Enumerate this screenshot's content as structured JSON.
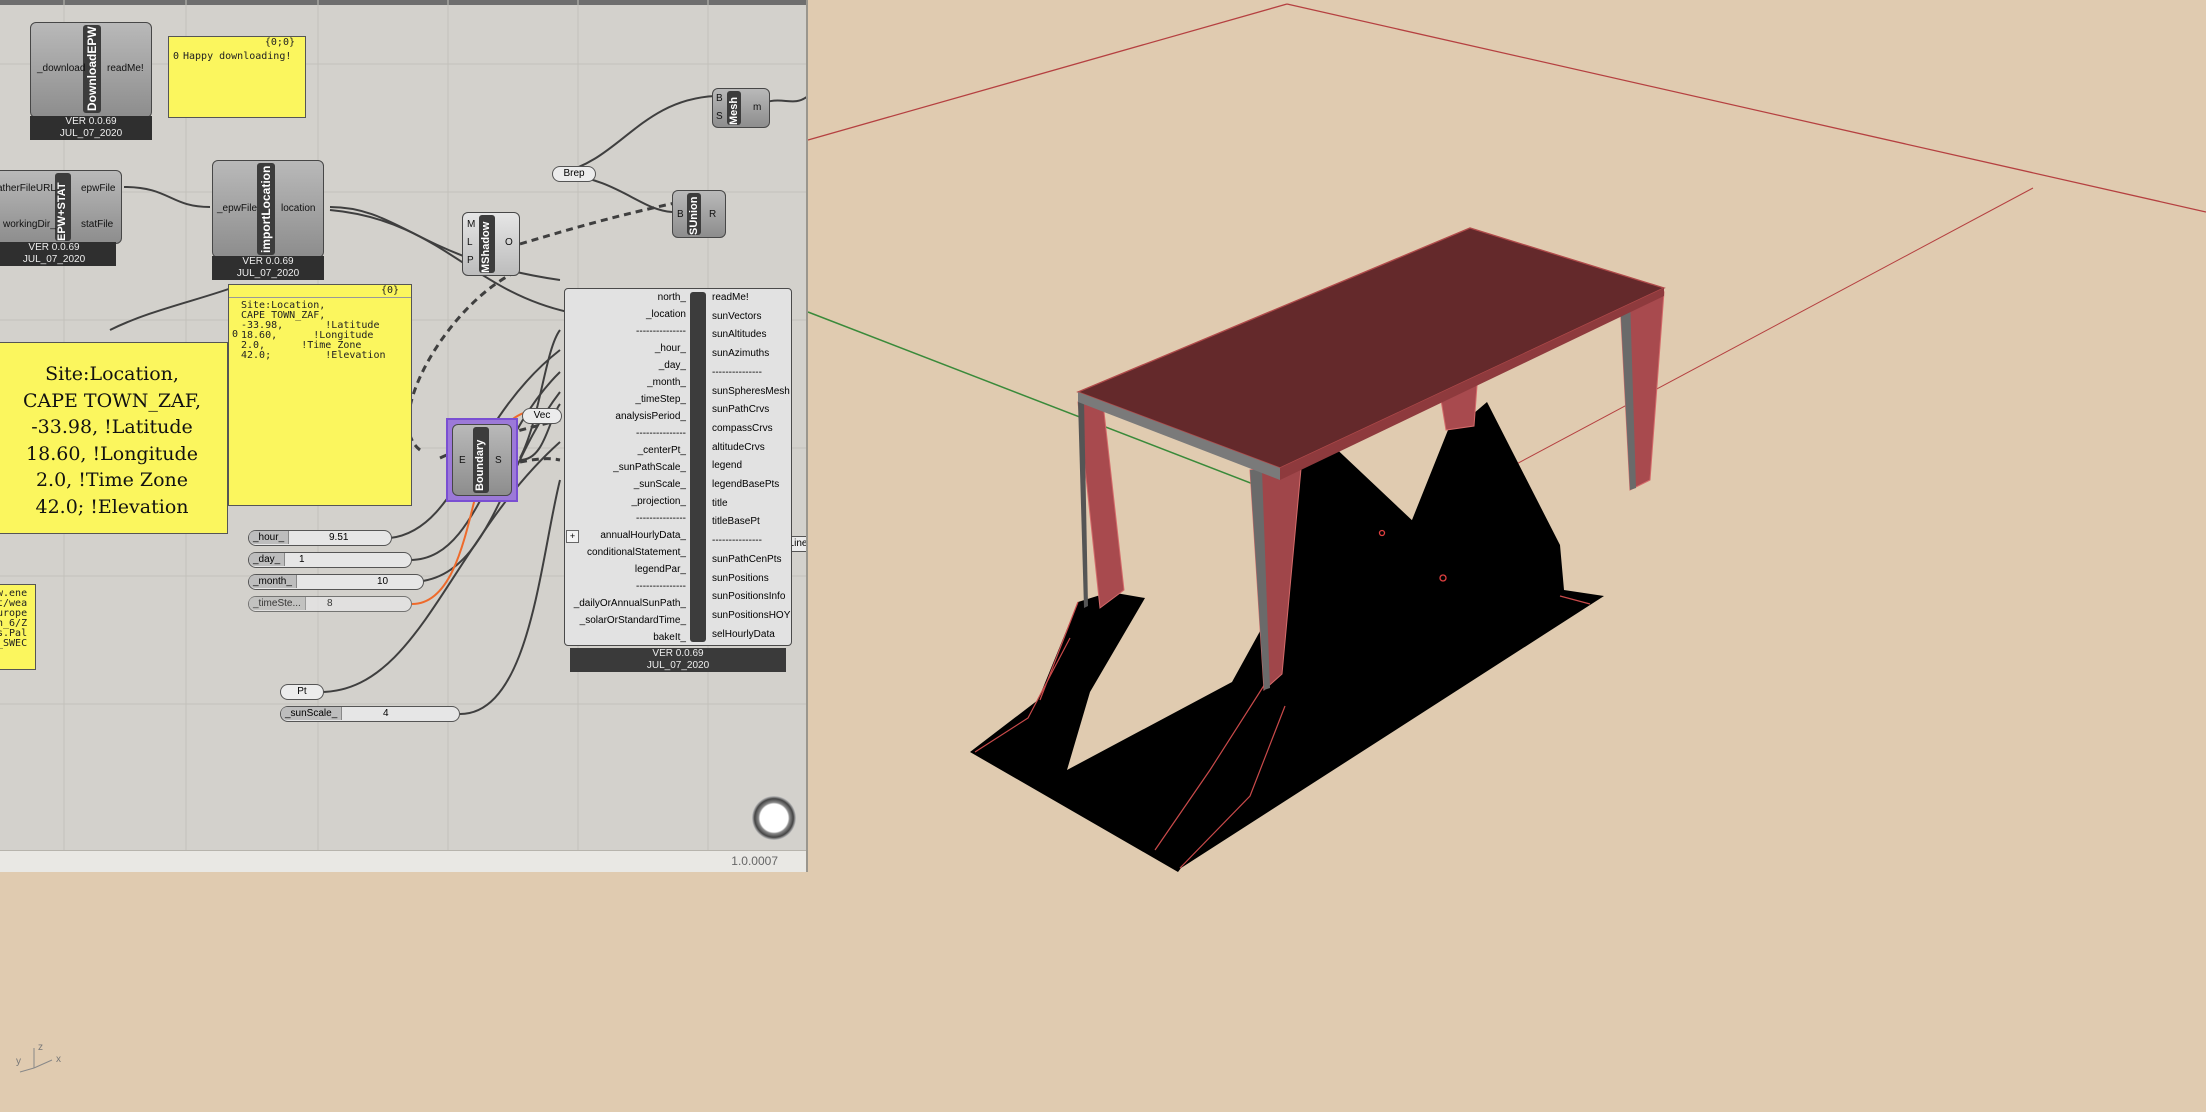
{
  "status": {
    "version": "1.0.0007"
  },
  "components": {
    "download_epw": {
      "name": "DownloadEPW",
      "in": "_download",
      "out": "readMe!",
      "ver": "VER 0.0.69",
      "date": "JUL_07_2020"
    },
    "epw_stat": {
      "name": "EPW+STAT",
      "in1": "atherFileURL",
      "in2": "workingDir_",
      "out1": "epwFile",
      "out2": "statFile",
      "ver": "VER 0.0.69",
      "date": "JUL_07_2020"
    },
    "import_location": {
      "name": "importLocation",
      "in": "_epwFile",
      "out": "location",
      "ver": "VER 0.0.69",
      "date": "JUL_07_2020"
    },
    "mesh": {
      "name": "Mesh",
      "in1": "B",
      "in2": "S",
      "out": "m"
    },
    "sunion": {
      "name": "SUnion",
      "in": "B",
      "out": "R"
    },
    "mshadow": {
      "name": "MShadow",
      "in1": "M",
      "in2": "L",
      "in3": "P",
      "out": "O"
    },
    "boundary": {
      "name": "Boundary",
      "in": "E",
      "out": "S"
    },
    "sunpath": {
      "name": "sunPath",
      "inputs": [
        "north_",
        "_location",
        "---------------",
        "_hour_",
        "_day_",
        "_month_",
        "_timeStep_",
        "analysisPeriod_",
        "---------------",
        "_centerPt_",
        "_sunPathScale_",
        "_sunScale_",
        "_projection_",
        "---------------",
        "annualHourlyData_",
        "conditionalStatement_",
        "legendPar_",
        "---------------",
        "_dailyOrAnnualSunPath_",
        "_solarOrStandardTime_",
        "bakeIt_"
      ],
      "outputs": [
        "readMe!",
        "sunVectors",
        "sunAltitudes",
        "sunAzimuths",
        "---------------",
        "sunSpheresMesh",
        "sunPathCrvs",
        "compassCrvs",
        "altitudeCrvs",
        "legend",
        "legendBasePts",
        "title",
        "titleBasePt",
        "---------------",
        "sunPathCenPts",
        "sunPositions",
        "sunPositionsInfo",
        "sunPositionsHOY",
        "selHourlyData"
      ],
      "ver": "VER 0.0.69",
      "date": "JUL_07_2020"
    }
  },
  "params": {
    "brep": "Brep",
    "vec": "Vec",
    "pt": "Pt",
    "line": "Line"
  },
  "sliders": [
    {
      "name": "_hour_",
      "value": "9.51"
    },
    {
      "name": "_day_",
      "value": "1"
    },
    {
      "name": "_month_",
      "value": "10"
    },
    {
      "name": "_timeSte...",
      "value": "8"
    },
    {
      "name": "_sunScale_",
      "value": "4"
    }
  ],
  "panels": {
    "happy": {
      "header": "{0;0}",
      "index": "0",
      "text": "Happy downloading!"
    },
    "site": {
      "header": "{0}",
      "index": "0",
      "lines": [
        "Site:Location,",
        "CAPE TOWN_ZAF,",
        "-33.98,       !Latitude",
        "18.60,      !Longitude",
        "2.0,      !Time Zone",
        "42.0;         !Elevation"
      ]
    },
    "big": {
      "lines": [
        "Site:Location,",
        "CAPE TOWN_ZAF,",
        "-33.98,      !Latitude",
        "18.60,     !Longitude",
        "2.0,      !Time Zone",
        "42.0;       !Elevation"
      ]
    },
    "partial": {
      "lines": [
        "w.ene",
        "t/wea",
        "",
        "urope",
        "n_6/Z",
        "s.Pal",
        "_SWEC"
      ]
    }
  },
  "viewport": {
    "axis_labels": [
      "y",
      "z",
      "x"
    ]
  },
  "colors": {
    "canvas": "#d3d1cc",
    "viewport": "#e0cbb0",
    "panel": "#fbf65e",
    "table_top": "#64292b",
    "shadow": "#000000"
  }
}
